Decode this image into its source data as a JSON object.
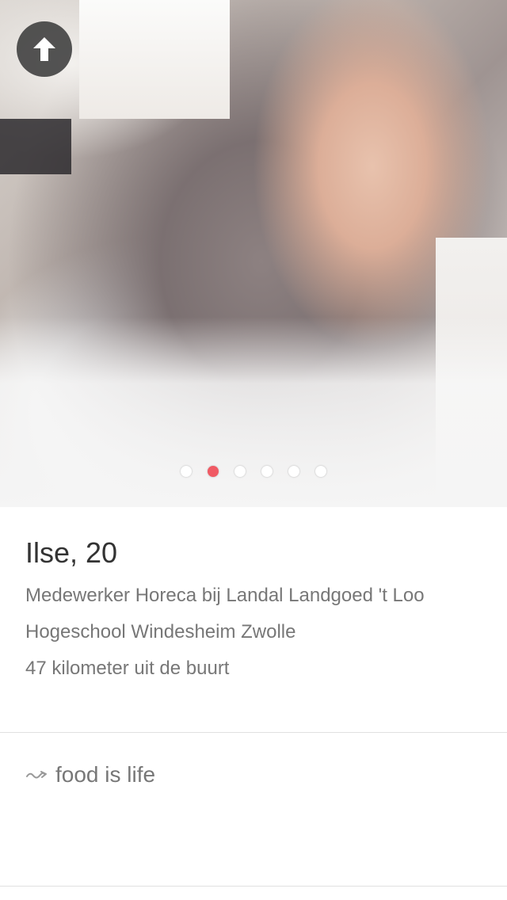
{
  "profile": {
    "name_age": "Ilse, 20",
    "job": "Medewerker Horeca bij Landal Landgoed 't Loo",
    "school": "Hogeschool Windesheim Zwolle",
    "distance": "47 kilometer uit de buurt",
    "bio": "food is life",
    "bio_icon": "squiggle-arrow-icon"
  },
  "photo": {
    "page_count": 6,
    "active_index": 1
  },
  "colors": {
    "active_dot": "#f05a64",
    "text_primary": "#333333",
    "text_secondary": "#777777",
    "divider": "#e0e0e0"
  },
  "icons": {
    "up_button": "arrow-up-icon"
  }
}
